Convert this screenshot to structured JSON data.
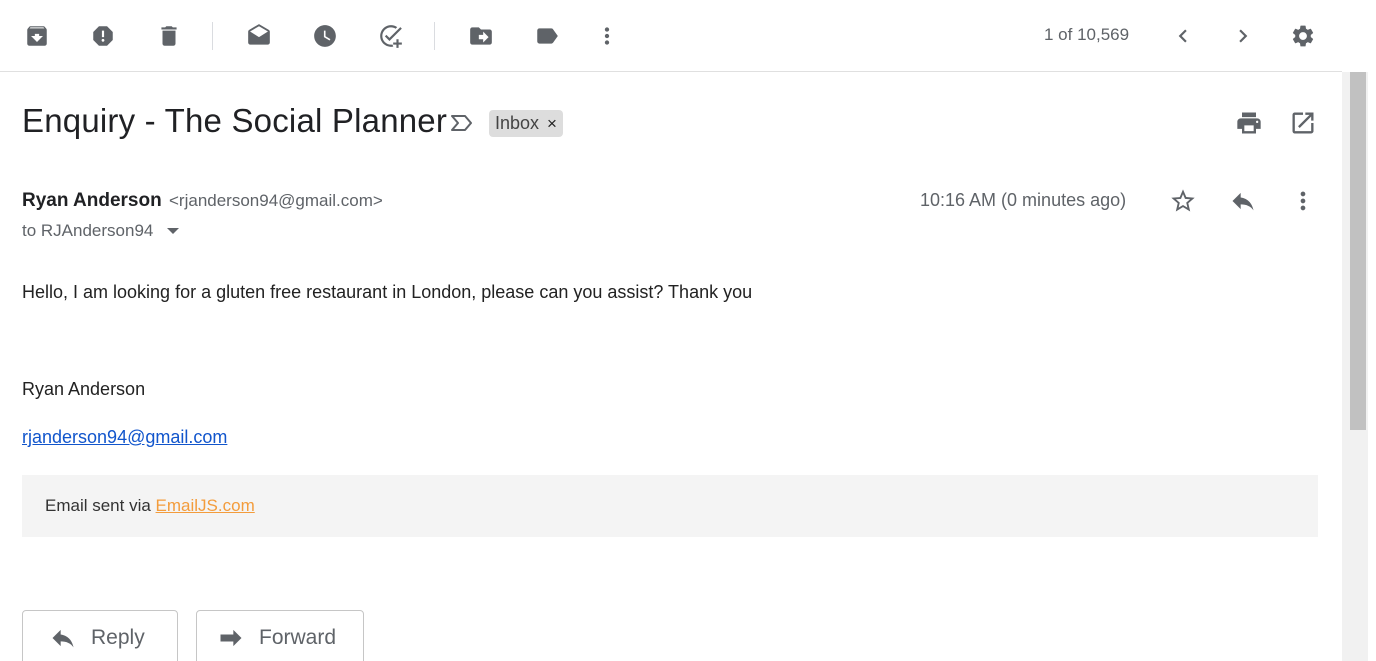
{
  "toolbar": {
    "icons": [
      "archive-icon",
      "report-spam-icon",
      "delete-icon",
      "mark-unread-icon",
      "snooze-icon",
      "add-to-tasks-icon",
      "move-to-icon",
      "labels-icon",
      "more-vert-icon"
    ],
    "pager_text": "1 of 10,569"
  },
  "message": {
    "subject": "Enquiry - The Social Planner",
    "label": "Inbox",
    "label_remove": "×",
    "sender_name": "Ryan Anderson",
    "sender_email": "<rjanderson94@gmail.com>",
    "to_text": "to RJAnderson94",
    "timestamp": "10:16 AM (0 minutes ago)",
    "body_line": "Hello, I am looking for a gluten free restaurant in London, please can you assist? Thank you",
    "signature_name": "Ryan Anderson",
    "signature_email": "rjanderson94@gmail.com",
    "footer_prefix": "Email sent via ",
    "footer_link": "EmailJS.com"
  },
  "actions": {
    "reply_label": "Reply",
    "forward_label": "Forward"
  },
  "colors": {
    "link": "#1155cc",
    "footer_link": "#f39c3c",
    "icon_gray": "#5f6368"
  }
}
